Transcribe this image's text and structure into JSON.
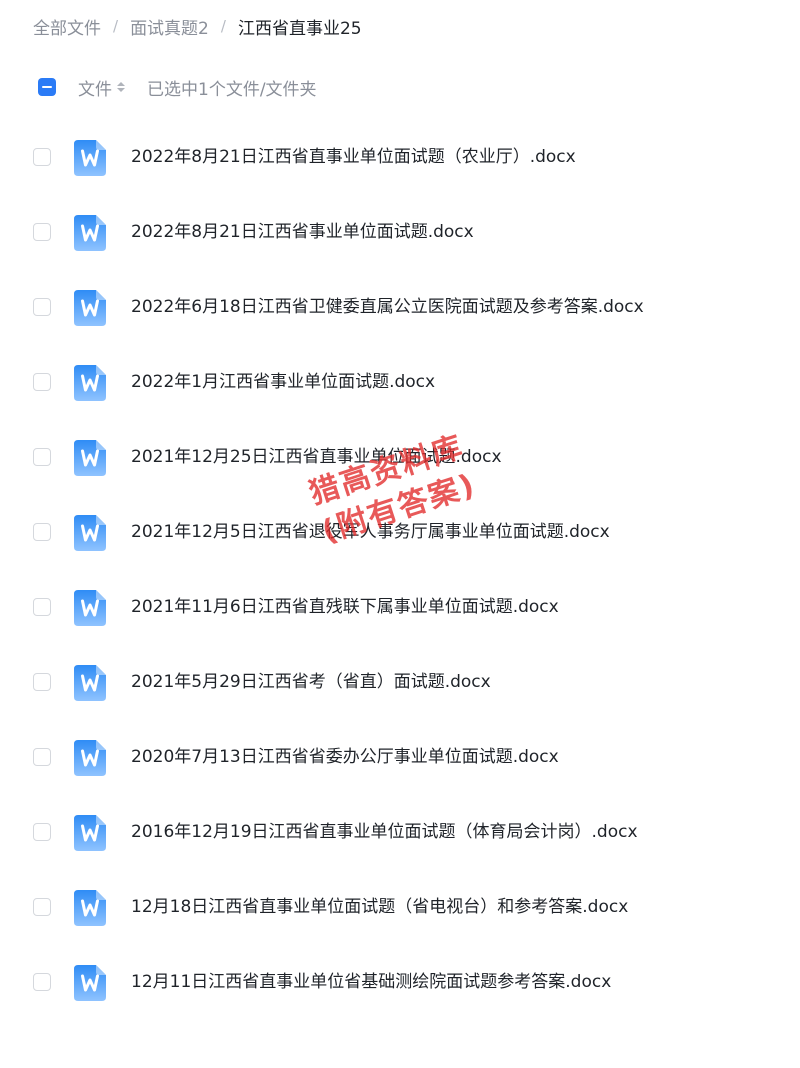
{
  "breadcrumb": {
    "items": [
      "全部文件",
      "面试真题2",
      "江西省直事业25"
    ],
    "separator": "/"
  },
  "list_header": {
    "column_label": "文件",
    "selection_text": "已选中1个文件/文件夹"
  },
  "files": [
    "2022年8月21日江西省直事业单位面试题（农业厅）.docx",
    "2022年8月21日江西省事业单位面试题.docx",
    "2022年6月18日江西省卫健委直属公立医院面试题及参考答案.docx",
    "2022年1月江西省事业单位面试题.docx",
    "2021年12月25日江西省直事业单位面试题.docx",
    "2021年12月5日江西省退役军人事务厅属事业单位面试题.docx",
    "2021年11月6日江西省直残联下属事业单位面试题.docx",
    "2021年5月29日江西省考（省直）面试题.docx",
    "2020年7月13日江西省省委办公厅事业单位面试题.docx",
    "2016年12月19日江西省直事业单位面试题（体育局会计岗）.docx",
    "12月18日江西省直事业单位面试题（省电视台）和参考答案.docx",
    "12月11日江西省直事业单位省基础测绘院面试题参考答案.docx"
  ],
  "file_icon": "word-document-icon",
  "watermark": {
    "line1": "猎高资料库",
    "line2": "(附有答案)"
  },
  "colors": {
    "accent": "#2b7bf6",
    "icon_top": "#2f8cf5",
    "icon_bottom": "#8fc3ff",
    "watermark": "#e22a2a"
  }
}
